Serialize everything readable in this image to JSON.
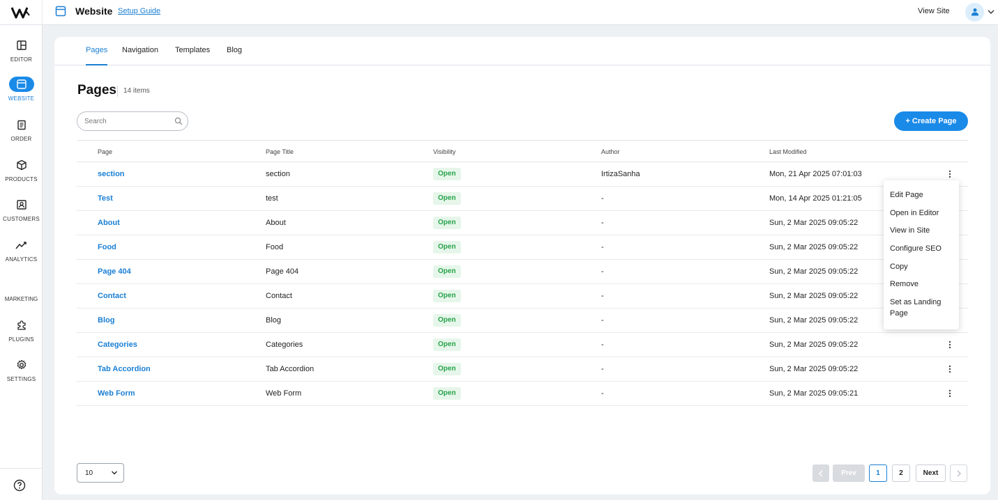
{
  "header": {
    "title": "Website",
    "setup_guide": "Setup Guide",
    "view_site": "View Site"
  },
  "sidebar": {
    "items": [
      {
        "label": "EDITOR",
        "icon": "layout-icon"
      },
      {
        "label": "WEBSITE",
        "icon": "browser-icon",
        "active": true
      },
      {
        "label": "ORDER",
        "icon": "clipboard-icon"
      },
      {
        "label": "PRODUCTS",
        "icon": "box-icon"
      },
      {
        "label": "CUSTOMERS",
        "icon": "contacts-icon"
      },
      {
        "label": "ANALYTICS",
        "icon": "trend-icon"
      }
    ],
    "section_label": "MARKETING",
    "extra_items": [
      {
        "label": "PLUGINS",
        "icon": "puzzle-icon"
      },
      {
        "label": "SETTINGS",
        "icon": "gear-icon"
      }
    ]
  },
  "tabs": [
    "Pages",
    "Navigation",
    "Templates",
    "Blog"
  ],
  "page": {
    "heading": "Pages",
    "count": "14 items",
    "search_placeholder": "Search",
    "create_label": "+ Create Page"
  },
  "table": {
    "columns": [
      "Page",
      "Page Title",
      "Visibility",
      "Author",
      "Last Modified"
    ],
    "rows": [
      {
        "page": "section",
        "title": "section",
        "visibility": "Open",
        "author": "IrtizaSanha",
        "modified": "Mon, 21 Apr 2025 07:01:03"
      },
      {
        "page": "Test",
        "title": "test",
        "visibility": "Open",
        "author": "-",
        "modified": "Mon, 14 Apr 2025 01:21:05"
      },
      {
        "page": "About",
        "title": "About",
        "visibility": "Open",
        "author": "-",
        "modified": "Sun, 2 Mar 2025 09:05:22"
      },
      {
        "page": "Food",
        "title": "Food",
        "visibility": "Open",
        "author": "-",
        "modified": "Sun, 2 Mar 2025 09:05:22"
      },
      {
        "page": "Page 404",
        "title": "Page 404",
        "visibility": "Open",
        "author": "-",
        "modified": "Sun, 2 Mar 2025 09:05:22"
      },
      {
        "page": "Contact",
        "title": "Contact",
        "visibility": "Open",
        "author": "-",
        "modified": "Sun, 2 Mar 2025 09:05:22"
      },
      {
        "page": "Blog",
        "title": "Blog",
        "visibility": "Open",
        "author": "-",
        "modified": "Sun, 2 Mar 2025 09:05:22"
      },
      {
        "page": "Categories",
        "title": "Categories",
        "visibility": "Open",
        "author": "-",
        "modified": "Sun, 2 Mar 2025 09:05:22"
      },
      {
        "page": "Tab Accordion",
        "title": "Tab Accordion",
        "visibility": "Open",
        "author": "-",
        "modified": "Sun, 2 Mar 2025 09:05:22"
      },
      {
        "page": "Web Form",
        "title": "Web Form",
        "visibility": "Open",
        "author": "-",
        "modified": "Sun, 2 Mar 2025 09:05:21"
      }
    ]
  },
  "context_menu": {
    "items": [
      "Edit Page",
      "Open in Editor",
      "View in Site",
      "Configure SEO",
      "Copy",
      "Remove",
      "Set as Landing Page"
    ]
  },
  "pagination": {
    "per_page": "10",
    "prev": "Prev",
    "pages": [
      "1",
      "2"
    ],
    "current": "1",
    "next": "Next"
  },
  "colors": {
    "accent": "#1a8ae8",
    "open_badge_bg": "#e6f6ea",
    "open_badge_text": "#27a24a"
  }
}
